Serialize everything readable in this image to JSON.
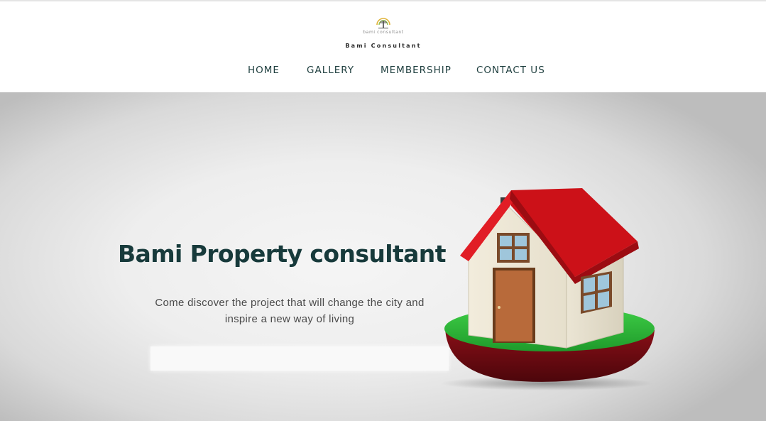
{
  "header": {
    "logo_small_text": "bami consultant",
    "brand_name": "Bami Consultant",
    "nav": [
      {
        "label": "HOME"
      },
      {
        "label": "GALLERY"
      },
      {
        "label": "MEMBERSHIP"
      },
      {
        "label": "CONTACT US"
      }
    ]
  },
  "hero": {
    "title": "Bami Property consultant",
    "subtitle": "Come discover the project that will change the city and inspire a new way of living",
    "illustration": "house-illustration"
  },
  "colors": {
    "nav_text": "#1f3f3f",
    "title_text": "#173a3b",
    "roof_red": "#d9141c",
    "grass_green": "#2fb53a",
    "base_maroon": "#6e0b12"
  }
}
